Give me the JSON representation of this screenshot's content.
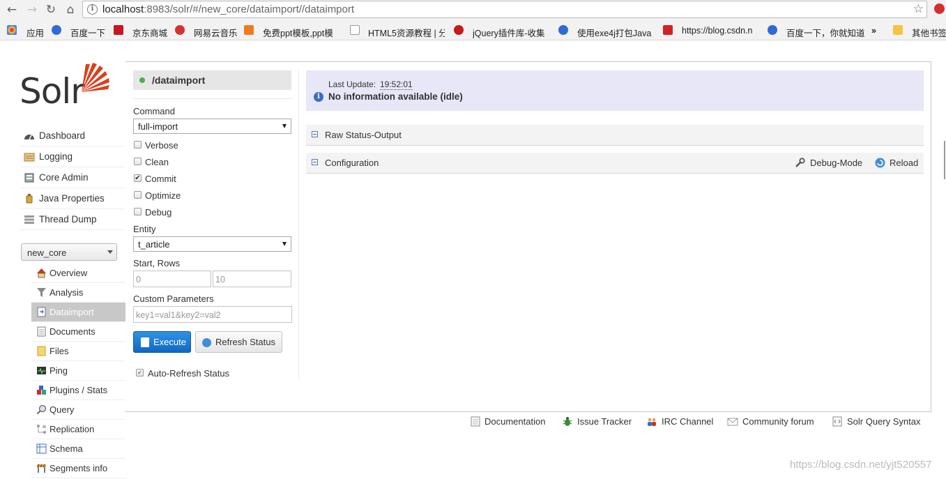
{
  "browser": {
    "url_host": "localhost",
    "url_rest": ":8983/solr/#/new_core/dataimport//dataimport",
    "bookmarks": [
      {
        "label": "应用",
        "color": "#e24a3b"
      },
      {
        "label": "百度一下",
        "color": "#2f6ad9"
      },
      {
        "label": "京东商城",
        "color": "#c81623"
      },
      {
        "label": "网易云音乐",
        "color": "#d63232"
      },
      {
        "label": "免费ppt模板,ppt模",
        "color": "#f07b1d"
      },
      {
        "label": "HTML5资源教程 | 分",
        "color": "#ffffff"
      },
      {
        "label": "jQuery插件库-收集",
        "color": "#c41a1a"
      },
      {
        "label": "使用exe4j打包Java",
        "color": "#2f6ad9"
      },
      {
        "label": "https://blog.csdn.n",
        "color": "#d32222"
      },
      {
        "label": "百度一下，你就知道",
        "color": "#2f6ad9"
      },
      {
        "label": "»",
        "color": ""
      },
      {
        "label": "其他书签",
        "color": "#f5c542"
      }
    ]
  },
  "logo": {
    "text": "Solr"
  },
  "sidebar": {
    "items": [
      {
        "label": "Dashboard",
        "icon": "dashboard-icon"
      },
      {
        "label": "Logging",
        "icon": "logging-icon"
      },
      {
        "label": "Core Admin",
        "icon": "core-admin-icon"
      },
      {
        "label": "Java Properties",
        "icon": "java-properties-icon"
      },
      {
        "label": "Thread Dump",
        "icon": "thread-dump-icon"
      }
    ],
    "core_selector": "new_core",
    "core_menu": [
      {
        "label": "Overview",
        "icon": "house-icon"
      },
      {
        "label": "Analysis",
        "icon": "funnel-icon"
      },
      {
        "label": "Dataimport",
        "icon": "dataimport-icon"
      },
      {
        "label": "Documents",
        "icon": "documents-icon"
      },
      {
        "label": "Files",
        "icon": "folder-icon"
      },
      {
        "label": "Ping",
        "icon": "ping-icon"
      },
      {
        "label": "Plugins / Stats",
        "icon": "plugins-icon"
      },
      {
        "label": "Query",
        "icon": "magnifier-icon"
      },
      {
        "label": "Replication",
        "icon": "replication-icon"
      },
      {
        "label": "Schema",
        "icon": "schema-icon"
      },
      {
        "label": "Segments info",
        "icon": "segments-icon"
      }
    ]
  },
  "dataimport": {
    "handler": "/dataimport",
    "command_label": "Command",
    "command_value": "full-import",
    "options": [
      {
        "label": "Verbose",
        "checked": false
      },
      {
        "label": "Clean",
        "checked": false
      },
      {
        "label": "Commit",
        "checked": true
      },
      {
        "label": "Optimize",
        "checked": false
      },
      {
        "label": "Debug",
        "checked": false
      }
    ],
    "entity_label": "Entity",
    "entity_value": "t_article",
    "start_rows_label": "Start, Rows",
    "start_value": "0",
    "rows_value": "10",
    "custom_params_label": "Custom Parameters",
    "custom_params_value": "key1=val1&key2=val2",
    "execute_label": "Execute",
    "refresh_label": "Refresh Status",
    "auto_refresh_label": "Auto-Refresh Status",
    "auto_refresh_checked": true
  },
  "status": {
    "last_update_label": "Last Update:",
    "last_update_time": "19:52:01",
    "message": "No information available (idle)"
  },
  "sections": {
    "raw_status": "Raw Status-Output",
    "configuration": "Configuration",
    "debug_mode": "Debug-Mode",
    "reload": "Reload"
  },
  "footer": [
    {
      "label": "Documentation",
      "icon": "document-icon"
    },
    {
      "label": "Issue Tracker",
      "icon": "bug-icon"
    },
    {
      "label": "IRC Channel",
      "icon": "people-icon"
    },
    {
      "label": "Community forum",
      "icon": "mail-icon"
    },
    {
      "label": "Solr Query Syntax",
      "icon": "syntax-icon"
    }
  ],
  "watermark": "https://blog.csdn.net/yjt520557"
}
